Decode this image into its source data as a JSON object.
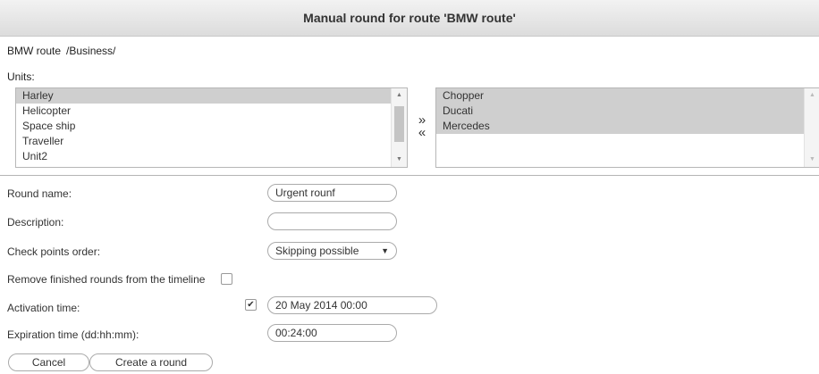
{
  "title": "Manual round for route 'BMW route'",
  "route": {
    "name": "BMW route",
    "path": "/Business/"
  },
  "units_label": "Units:",
  "available_units": [
    {
      "label": "Harley",
      "selected": true
    },
    {
      "label": "Helicopter",
      "selected": false
    },
    {
      "label": "Space ship",
      "selected": false
    },
    {
      "label": "Traveller",
      "selected": false
    },
    {
      "label": "Unit2",
      "selected": false
    }
  ],
  "assigned_units": [
    {
      "label": "Chopper",
      "selected": true
    },
    {
      "label": "Ducati",
      "selected": true
    },
    {
      "label": "Mercedes",
      "selected": true
    }
  ],
  "move_buttons": {
    "add": "»",
    "remove": "«"
  },
  "form": {
    "round_name_label": "Round name:",
    "round_name_value": "Urgent rounf",
    "description_label": "Description:",
    "description_value": "",
    "check_points_order_label": "Check points order:",
    "check_points_order_value": "Skipping possible",
    "remove_finished_label": "Remove finished rounds from the timeline",
    "remove_finished_checked": false,
    "activation_time_label": "Activation time:",
    "activation_time_checked": true,
    "activation_time_value": "20 May 2014 00:00",
    "expiration_time_label": "Expiration time (dd:hh:mm):",
    "expiration_time_value": "00:24:00"
  },
  "buttons": {
    "cancel": "Cancel",
    "create": "Create a round"
  },
  "icons": {
    "checkmark": "✔",
    "caret": "▼",
    "scroll_up": "▲",
    "scroll_down": "▼"
  }
}
